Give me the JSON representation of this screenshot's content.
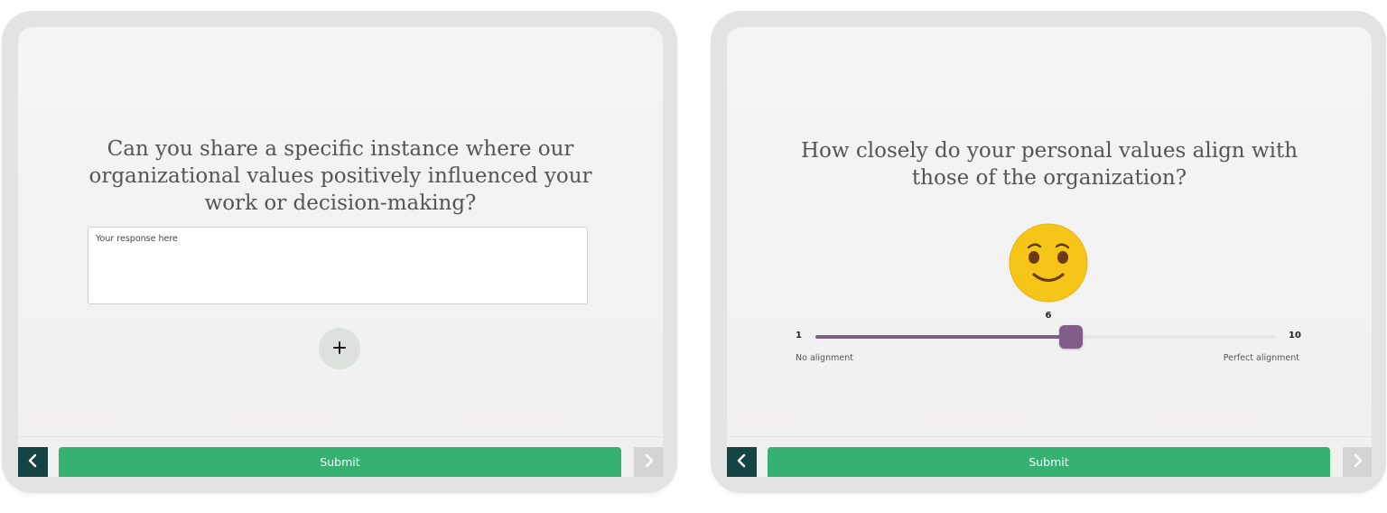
{
  "colors": {
    "submit_green": "#37b172",
    "back_button": "#144444",
    "slider_purple": "#825d8a",
    "emoji_yellow": "#f5c518"
  },
  "left_screen": {
    "question": "Can you share a specific instance where our organizational values positively influenced your work or decision-making?",
    "response_placeholder": "Your response here",
    "add_icon": "plus-icon",
    "back_icon": "chevron-left-icon",
    "submit_label": "Submit",
    "next_icon": "chevron-right-icon"
  },
  "right_screen": {
    "question": "How closely do your personal values align with those of the organization?",
    "emoji_icon": "smiling-face-icon",
    "slider": {
      "value": "6",
      "min": "1",
      "max": "10",
      "min_label": "No alignment",
      "max_label": "Perfect alignment"
    },
    "back_icon": "chevron-left-icon",
    "submit_label": "Submit",
    "next_icon": "chevron-right-icon"
  }
}
